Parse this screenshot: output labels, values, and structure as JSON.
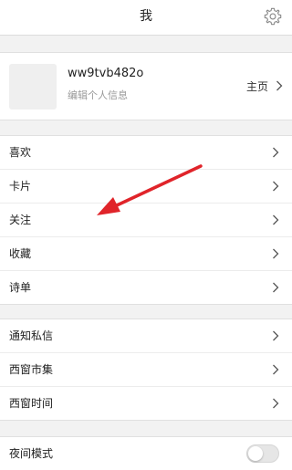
{
  "header": {
    "title": "我"
  },
  "profile": {
    "username": "ww9tvb482o",
    "subtitle": "编辑个人信息",
    "homepage_label": "主页"
  },
  "groups": [
    {
      "items": [
        {
          "label": "喜欢"
        },
        {
          "label": "卡片"
        },
        {
          "label": "关注"
        },
        {
          "label": "收藏"
        },
        {
          "label": "诗单"
        }
      ]
    },
    {
      "items": [
        {
          "label": "通知私信"
        },
        {
          "label": "西窗市集"
        },
        {
          "label": "西窗时间"
        }
      ]
    },
    {
      "items": [
        {
          "label": "夜间模式"
        }
      ]
    }
  ],
  "settings": {
    "night_mode_on": false
  },
  "colors": {
    "annotation_arrow": "#e0242a",
    "accent_gray": "#999999"
  }
}
